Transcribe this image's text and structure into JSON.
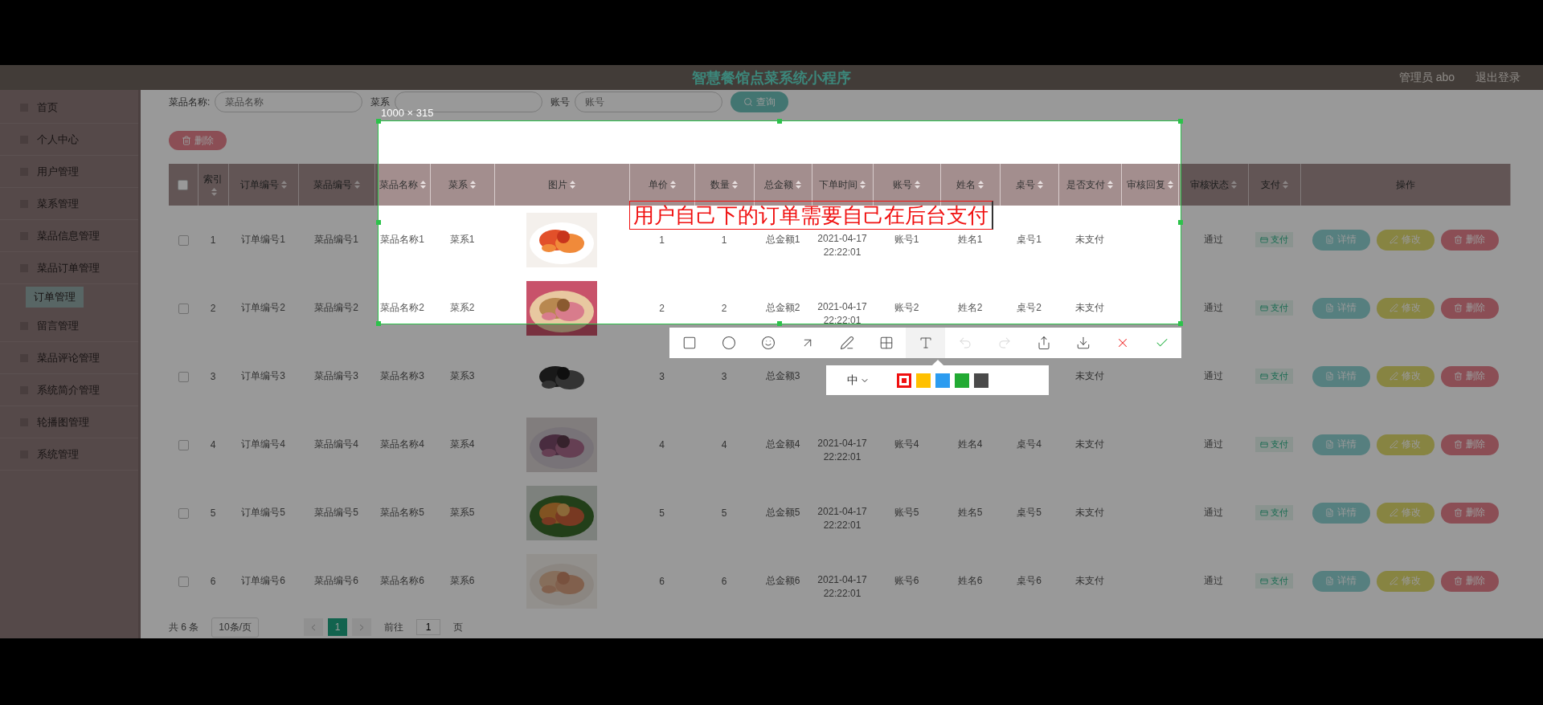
{
  "page": {
    "header": {
      "title": "智慧餐馆点菜系统小程序",
      "user": "管理员 abo",
      "logout": "退出登录"
    },
    "sidebar": [
      {
        "label": "首页",
        "selected": false
      },
      {
        "label": "个人中心",
        "selected": false
      },
      {
        "label": "用户管理",
        "selected": false
      },
      {
        "label": "菜系管理",
        "selected": false
      },
      {
        "label": "菜品信息管理",
        "selected": false
      },
      {
        "label": "菜品订单管理",
        "selected": false,
        "children": [
          {
            "label": "订单管理",
            "selected": true
          }
        ]
      },
      {
        "label": "留言管理",
        "selected": false
      },
      {
        "label": "菜品评论管理",
        "selected": false
      },
      {
        "label": "系统简介管理",
        "selected": false
      },
      {
        "label": "轮播图管理",
        "selected": false
      },
      {
        "label": "系统管理",
        "selected": false
      }
    ],
    "search": {
      "fields": [
        {
          "label": "菜品名称:",
          "placeholder": "菜品名称"
        },
        {
          "label": "菜系"
        },
        {
          "label": "账号",
          "placeholder": "账号"
        }
      ],
      "query_button": "查询"
    },
    "delete_button": "删除",
    "table": {
      "select_all": {
        "checked": false
      },
      "columns": [
        "索引",
        "订单编号",
        "菜品编号",
        "菜品名称",
        "菜系",
        "图片",
        "单价",
        "数量",
        "总金额",
        "下单时间",
        "账号",
        "姓名",
        "桌号",
        "是否支付",
        "审核回复",
        "审核状态",
        "支付",
        "操作"
      ],
      "rows": [
        {
          "checked": false,
          "index": "1",
          "order_no": "订单编号1",
          "dish_no": "菜品编号1",
          "dish_name": "菜品名称1",
          "cuisine": "菜系1",
          "price": "1",
          "qty": "1",
          "total": "总金额1",
          "time": "2021-04-17 22:22:01",
          "account": "账号1",
          "name": "姓名1",
          "table_no": "桌号1",
          "paid": "未支付",
          "status": "通过",
          "pay": "支付",
          "actions": [
            "详情",
            "修改",
            "删除"
          ]
        },
        {
          "checked": false,
          "index": "2",
          "order_no": "订单编号2",
          "dish_no": "菜品编号2",
          "dish_name": "菜品名称2",
          "cuisine": "菜系2",
          "price": "2",
          "qty": "2",
          "total": "总金额2",
          "time": "2021-04-17 22:22:01",
          "account": "账号2",
          "name": "姓名2",
          "table_no": "桌号2",
          "paid": "未支付",
          "status": "通过",
          "pay": "支付",
          "actions": [
            "详情",
            "修改",
            "删除"
          ]
        },
        {
          "checked": false,
          "index": "3",
          "order_no": "订单编号3",
          "dish_no": "菜品编号3",
          "dish_name": "菜品名称3",
          "cuisine": "菜系3",
          "price": "3",
          "qty": "3",
          "total": "总金额3",
          "paid": "未支付",
          "status": "通过",
          "pay": "支付",
          "actions": [
            "详情",
            "修改",
            "删除"
          ]
        },
        {
          "checked": false,
          "index": "4",
          "order_no": "订单编号4",
          "dish_no": "菜品编号4",
          "dish_name": "菜品名称4",
          "cuisine": "菜系4",
          "price": "4",
          "qty": "4",
          "total": "总金额4",
          "time": "2021-04-17 22:22:01",
          "account": "账号4",
          "name": "姓名4",
          "table_no": "桌号4",
          "paid": "未支付",
          "status": "通过",
          "pay": "支付",
          "actions": [
            "详情",
            "修改",
            "删除"
          ]
        },
        {
          "checked": false,
          "index": "5",
          "order_no": "订单编号5",
          "dish_no": "菜品编号5",
          "dish_name": "菜品名称5",
          "cuisine": "菜系5",
          "price": "5",
          "qty": "5",
          "total": "总金额5",
          "time": "2021-04-17 22:22:01",
          "account": "账号5",
          "name": "姓名5",
          "table_no": "桌号5",
          "paid": "未支付",
          "status": "通过",
          "pay": "支付",
          "actions": [
            "详情",
            "修改",
            "删除"
          ]
        },
        {
          "checked": false,
          "index": "6",
          "order_no": "订单编号6",
          "dish_no": "菜品编号6",
          "dish_name": "菜品名称6",
          "cuisine": "菜系6",
          "price": "6",
          "qty": "6",
          "total": "总金额6",
          "time": "2021-04-17 22:22:01",
          "account": "账号6",
          "name": "姓名6",
          "table_no": "桌号6",
          "paid": "未支付",
          "status": "通过",
          "pay": "支付",
          "actions": [
            "详情",
            "修改",
            "删除"
          ]
        }
      ]
    },
    "pagination": {
      "total": "共 6 条",
      "page_size": "10条/页",
      "pages": [
        {
          "label": "1",
          "selected": true
        }
      ],
      "goto_label": "前往",
      "goto_value": "1",
      "goto_suffix": "页"
    }
  },
  "capture_tool": {
    "size_label": "1000 × 315",
    "annotation": "用户自己下的订单需要自己在后台支付",
    "tools": [
      {
        "kind": "rectangle",
        "selected": false,
        "disabled": false
      },
      {
        "kind": "ellipse",
        "selected": false,
        "disabled": false
      },
      {
        "kind": "emoji",
        "selected": false,
        "disabled": false
      },
      {
        "kind": "arrow",
        "selected": false,
        "disabled": false
      },
      {
        "kind": "pen",
        "selected": false,
        "disabled": false
      },
      {
        "kind": "mosaic",
        "selected": false,
        "disabled": false
      },
      {
        "kind": "text",
        "selected": true,
        "disabled": false
      },
      {
        "kind": "undo",
        "selected": false,
        "disabled": true
      },
      {
        "kind": "redo",
        "selected": false,
        "disabled": true
      },
      {
        "kind": "share",
        "selected": false,
        "disabled": false
      },
      {
        "kind": "download",
        "selected": false,
        "disabled": false
      },
      {
        "kind": "cancel",
        "selected": false,
        "disabled": false
      },
      {
        "kind": "confirm",
        "selected": false,
        "disabled": false
      }
    ],
    "font_size": "中",
    "colors": [
      {
        "color": "#f01010",
        "selected": true
      },
      {
        "color": "#ffc000",
        "selected": false
      },
      {
        "color": "#2c9cf0",
        "selected": false
      },
      {
        "color": "#22aa33",
        "selected": false
      },
      {
        "color": "#4a4a4a",
        "selected": false
      }
    ]
  }
}
